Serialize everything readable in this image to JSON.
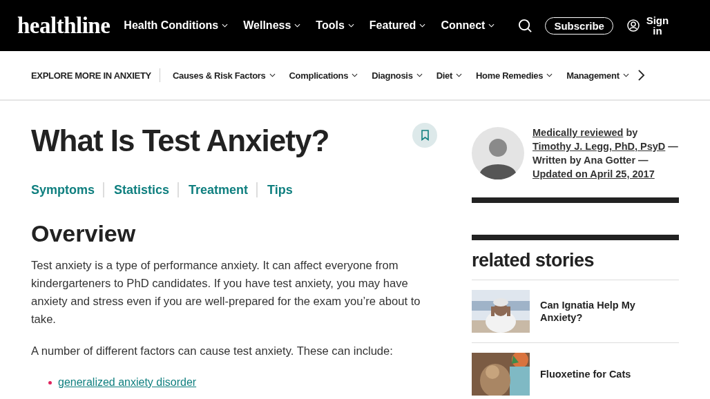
{
  "header": {
    "logo": "healthline",
    "nav": [
      {
        "label": "Health Conditions"
      },
      {
        "label": "Wellness"
      },
      {
        "label": "Tools"
      },
      {
        "label": "Featured"
      },
      {
        "label": "Connect"
      }
    ],
    "subscribe": "Subscribe",
    "sign_in": "Sign in"
  },
  "subnav": {
    "title": "EXPLORE MORE IN ANXIETY",
    "items": [
      {
        "label": "Causes & Risk Factors"
      },
      {
        "label": "Complications"
      },
      {
        "label": "Diagnosis"
      },
      {
        "label": "Diet"
      },
      {
        "label": "Home Remedies"
      },
      {
        "label": "Management"
      }
    ]
  },
  "article": {
    "title": "What Is Test Anxiety?",
    "bookmarked": false,
    "jump_links": [
      "Symptoms",
      "Statistics",
      "Treatment",
      "Tips"
    ],
    "heading": "Overview",
    "paragraphs": [
      "Test anxiety is a type of performance anxiety. It can affect everyone from kindergarteners to PhD candidates. If you have test anxiety, you may have anxiety and stress even if you are well-prepared for the exam you’re about to take.",
      "A number of different factors can cause test anxiety. These can include:"
    ],
    "list": [
      "generalized anxiety disorder"
    ]
  },
  "byline": [
    {
      "kind": "link",
      "text": "Medically reviewed"
    },
    {
      "kind": "text",
      "text": " by "
    },
    {
      "kind": "link",
      "text": "Timothy J. Legg, PhD, PsyD"
    },
    {
      "kind": "text",
      "text": " — Written by Ana Gotter — "
    },
    {
      "kind": "link",
      "text": "Updated on April 25, 2017"
    }
  ],
  "related": {
    "title": "related stories",
    "stories": [
      {
        "title": "Can Ignatia Help My Anxiety?",
        "kind": "picture"
      },
      {
        "title": "Fluoxetine for Cats",
        "kind": "picture"
      }
    ]
  }
}
